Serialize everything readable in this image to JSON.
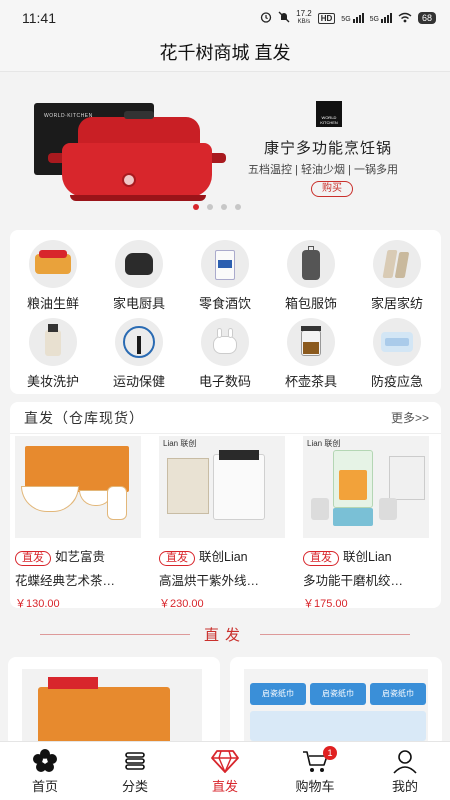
{
  "status_bar": {
    "time": "11:41",
    "speed_value": "17.2",
    "speed_unit": "KB/s",
    "hd": "HD",
    "signal1": "5G",
    "signal2": "5G",
    "battery": "68"
  },
  "title_bar": {
    "title": "花千树商城  直发"
  },
  "banner": {
    "brand_box_text": "WORLD·KITCHEN",
    "brand_logo_text": "WORLD KITCHEN",
    "title": "康宁多功能烹饪锅",
    "subtitle": "五档温控 | 轻油少烟 | 一锅多用",
    "buy_button": "购买",
    "active_slide": 1,
    "slide_count": 4
  },
  "categories": [
    {
      "label": "粮油生鲜",
      "icon": "grain-fresh-icon"
    },
    {
      "label": "家电厨具",
      "icon": "rice-cooker-icon"
    },
    {
      "label": "零食酒饮",
      "icon": "snack-drink-icon"
    },
    {
      "label": "箱包服饰",
      "icon": "luggage-icon"
    },
    {
      "label": "家居家纺",
      "icon": "home-textile-icon"
    },
    {
      "label": "美妆洗护",
      "icon": "cosmetics-icon"
    },
    {
      "label": "运动保健",
      "icon": "sport-health-icon"
    },
    {
      "label": "电子数码",
      "icon": "earbuds-icon"
    },
    {
      "label": "杯壶茶具",
      "icon": "teapot-icon"
    },
    {
      "label": "防疫应急",
      "icon": "mask-icon"
    }
  ],
  "direct_section": {
    "title": "直发（仓库现货）",
    "more": "更多>>",
    "tag": "直发",
    "products": [
      {
        "brand": "如艺富贵",
        "name": "花蝶经典艺术茶…",
        "price": "￥130.00"
      },
      {
        "brand": "联创Lian",
        "name": "高温烘干紫外线…",
        "price": "￥230.00"
      },
      {
        "brand": "联创Lian",
        "name": "多功能干磨机绞…",
        "price": "￥175.00"
      }
    ],
    "brand_logo_text": "Lian 联创"
  },
  "divider": {
    "title": "直发"
  },
  "bottom_cards": {
    "tissue_text": "启瓷纸巾"
  },
  "tabbar": {
    "items": [
      {
        "label": "首页",
        "icon": "home-flower-icon"
      },
      {
        "label": "分类",
        "icon": "category-icon"
      },
      {
        "label": "直发",
        "icon": "diamond-icon"
      },
      {
        "label": "购物车",
        "icon": "cart-icon"
      },
      {
        "label": "我的",
        "icon": "profile-icon"
      }
    ],
    "active": "直发",
    "cart_badge": "1"
  },
  "colors": {
    "accent": "#d8262c",
    "background": "#f3f3f3"
  }
}
